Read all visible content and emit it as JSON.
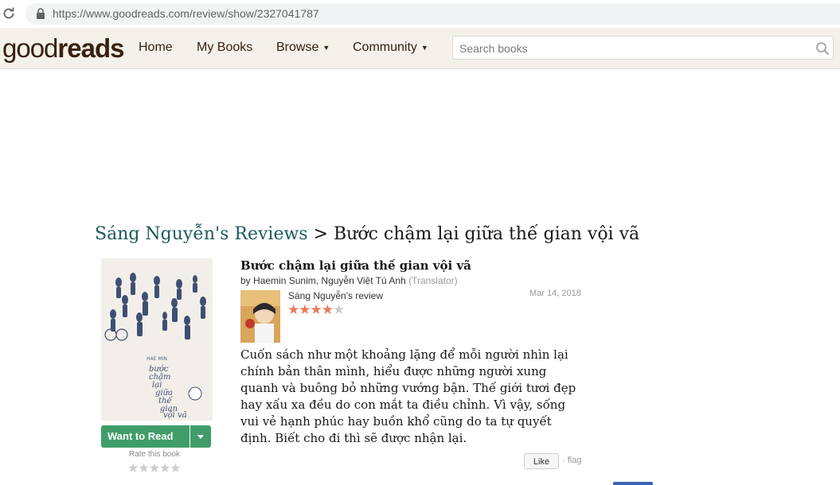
{
  "browser": {
    "url": "https://www.goodreads.com/review/show/2327041787"
  },
  "header": {
    "logo_good": "good",
    "logo_reads": "reads",
    "nav": [
      {
        "label": "Home",
        "caret": false
      },
      {
        "label": "My Books",
        "caret": false
      },
      {
        "label": "Browse",
        "caret": true
      },
      {
        "label": "Community",
        "caret": true
      }
    ],
    "search_placeholder": "Search books"
  },
  "heading": {
    "reviews_link": "Sáng Nguyễn's Reviews",
    "separator": " > ",
    "book_title": "Bước chậm lại giữa thế gian vội vã"
  },
  "book": {
    "title": "Bước chậm lại giữa thế gian vội vã",
    "by": "by",
    "author": "Haemin Sunim",
    "author_sep": ", ",
    "translator": "Nguyễn Việt Tú Anh",
    "translator_role": "(Translator)",
    "want_to_read": "Want to Read",
    "rate_label": "Rate this book",
    "user_rating": 0
  },
  "review": {
    "reviewer_label": "Sáng Nguyễn's review",
    "date": "Mar 14, 2018",
    "rating": 4,
    "rating_max": 5,
    "body": "Cuốn sách như một khoảng lặng để mỗi người nhìn lại chính bản thân mình, hiểu được những người xung quanh và buông bỏ những vướng bận. Thế giới tươi đẹp hay xấu xa đều do con mắt ta điều chỉnh. Vì vậy, sống vui vẻ hạnh phúc hay buồn khổ cũng do ta tự quyết định. Biết cho đi thì sẽ được nhận lại.",
    "like_label": "Like",
    "flag_label": "flag",
    "flag_prefix": "· "
  },
  "colors": {
    "header_bg": "#f4f1ea",
    "logo_brown": "#382110",
    "link_teal": "#1c5a5a",
    "button_green": "#409d69",
    "star_orange": "#e87b5b"
  }
}
